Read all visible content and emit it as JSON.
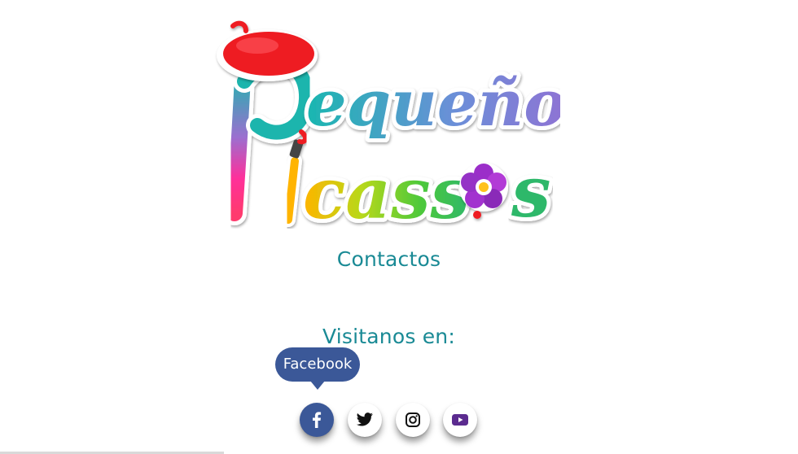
{
  "logo": {
    "line1": "Pequeños",
    "line2": "Picassos"
  },
  "contact_link": "Contactos",
  "visit_title": "Visitanos en:",
  "tooltip": "Facebook",
  "social": [
    {
      "name": "Facebook",
      "icon": "facebook-icon",
      "color": "#3b5898"
    },
    {
      "name": "Twitter",
      "icon": "twitter-icon",
      "color": "#111111"
    },
    {
      "name": "Instagram",
      "icon": "instagram-icon",
      "color": "#111111"
    },
    {
      "name": "YouTube",
      "icon": "youtube-icon",
      "color": "#5b2b8f"
    }
  ],
  "colors": {
    "text_teal": "#1a8a95",
    "facebook_blue": "#3b5898",
    "beret_red": "#ee1c24"
  }
}
